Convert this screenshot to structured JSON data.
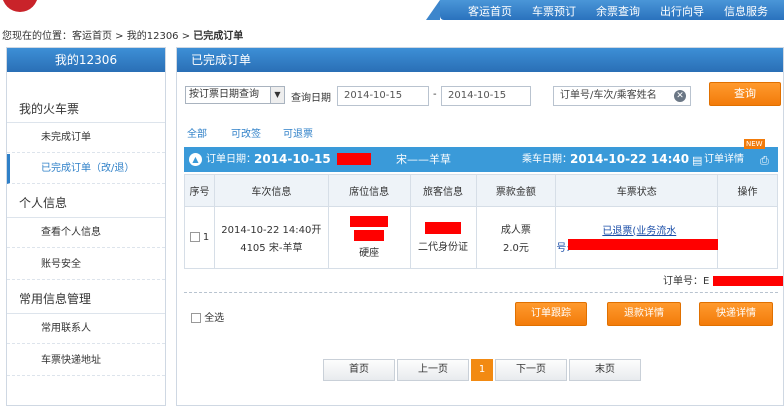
{
  "nav": {
    "items": [
      "客运首页",
      "车票预订",
      "余票查询",
      "出行向导",
      "信息服务"
    ]
  },
  "breadcrumb": {
    "prefix": "您现在的位置：",
    "path": "客运首页 > 我的12306 > ",
    "current": "已完成订单"
  },
  "sidebar": {
    "title": "我的12306",
    "sec_train": "我的火车票",
    "item_unfinished": "未完成订单",
    "item_finished": "已完成订单（改/退）",
    "sec_personal": "个人信息",
    "item_view_info": "查看个人信息",
    "item_security": "账号安全",
    "sec_common": "常用信息管理",
    "item_contacts": "常用联系人",
    "item_address": "车票快递地址"
  },
  "main": {
    "title": "已完成订单",
    "query_type": "按订票日期查询",
    "date_label": "查询日期",
    "date_from": "2014-10-15",
    "date_sep": "-",
    "date_to": "2014-10-15",
    "search_placeholder": "订单号/车次/乘客姓名",
    "query_btn": "查询",
    "filter_all": "全部",
    "filter_changeable": "可改签",
    "filter_refundable": "可退票"
  },
  "order": {
    "order_date_label": "订单日期：",
    "order_date": "2014-10-15",
    "route": "宋——羊草",
    "ride_date_label": "乘车日期：",
    "ride_datetime": "2014-10-22 14:40",
    "detail_link": "订单详情",
    "new_badge": "NEW",
    "order_no_label": "订单号：E"
  },
  "table": {
    "headers": [
      "序号",
      "车次信息",
      "席位信息",
      "旅客信息",
      "票款金额",
      "车票状态",
      "操作"
    ],
    "row": {
      "index": "1",
      "train_line1": "2014-10-22 14:40开",
      "train_line2": "4105 宋-羊草",
      "seat": "硬座",
      "passenger_id": "二代身份证",
      "ticket_type": "成人票",
      "price": "2.0元",
      "status_line1": "已退票(业务流水",
      "status_line2": "号:"
    }
  },
  "footer": {
    "select_all": "全选",
    "btn_track": "订单跟踪",
    "btn_refund": "退款详情",
    "btn_express": "快递详情"
  },
  "pager": {
    "first": "首页",
    "prev": "上一页",
    "current": "1",
    "next": "下一页",
    "last": "末页"
  },
  "colors": {
    "accent_blue": "#2f80c8",
    "header_blue": "#3a9ad9",
    "orange": "#f27b0a",
    "redaction": "#ff0000"
  }
}
